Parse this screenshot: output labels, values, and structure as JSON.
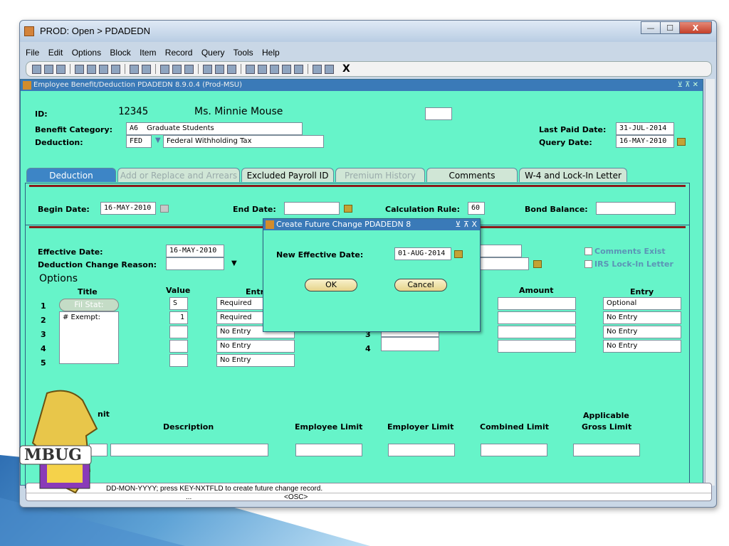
{
  "window": {
    "title": "PROD: Open > PDADEDN",
    "controls": {
      "minimize": "—",
      "maximize": "☐",
      "close": "X"
    }
  },
  "menu": [
    "File",
    "Edit",
    "Options",
    "Block",
    "Item",
    "Record",
    "Query",
    "Tools",
    "Help"
  ],
  "toolbar": {
    "exit_label": "X"
  },
  "form": {
    "title": "Employee Benefit/Deduction  PDADEDN  8.9.0.4  (Prod-MSU)",
    "id_label": "ID:",
    "id_value": "12345",
    "name_value": "Ms. Minnie Mouse",
    "benefit_category_label": "Benefit Category:",
    "benefit_category_code": "A6",
    "benefit_category_desc": "Graduate Students",
    "deduction_label": "Deduction:",
    "deduction_code": "FED",
    "deduction_desc": "Federal Withholding Tax",
    "last_paid_label": "Last Paid Date:",
    "last_paid_value": "31-JUL-2014",
    "query_date_label": "Query Date:",
    "query_date_value": "16-MAY-2010"
  },
  "tabs": [
    {
      "label": "Deduction",
      "state": "active"
    },
    {
      "label": "Add or Replace and Arrears",
      "state": "disabled"
    },
    {
      "label": "Excluded Payroll ID",
      "state": "normal"
    },
    {
      "label": "Premium History",
      "state": "disabled"
    },
    {
      "label": "Comments",
      "state": "normal"
    },
    {
      "label": "W-4 and Lock-In Letter",
      "state": "normal"
    }
  ],
  "deduction": {
    "begin_date_label": "Begin Date:",
    "begin_date_value": "16-MAY-2010",
    "end_date_label": "End Date:",
    "calc_rule_label": "Calculation Rule:",
    "calc_rule_value": "60",
    "bond_balance_label": "Bond Balance:",
    "effective_date_label": "Effective Date:",
    "effective_date_value": "16-MAY-2010",
    "change_reason_label": "Deduction Change Reason:",
    "comments_exist_label": "Comments Exist",
    "irs_lockin_label": "IRS Lock-In Letter",
    "options_label": "Options",
    "col_title": "Title",
    "col_value": "Value",
    "col_entry_left": "Entr",
    "col_amount": "Amount",
    "col_entry_right": "Entry",
    "rows_left": [
      {
        "num": "1",
        "title": "Fil Stat:",
        "value": "S",
        "entry": "Required"
      },
      {
        "num": "2",
        "title": "# Exempt:",
        "value": "1",
        "entry": "Required"
      },
      {
        "num": "3",
        "title": "",
        "value": "",
        "entry": "No Entry"
      },
      {
        "num": "4",
        "title": "",
        "value": "",
        "entry": "No Entry"
      },
      {
        "num": "5",
        "title": "",
        "value": "",
        "entry": "No Entry"
      }
    ],
    "rows_right": [
      {
        "num": "",
        "amount": "",
        "entry": "Optional"
      },
      {
        "num": "2",
        "amount": "",
        "entry": "No Entry"
      },
      {
        "num": "3",
        "amount": "",
        "entry": "No Entry"
      },
      {
        "num": "4",
        "amount": "",
        "entry": "No Entry"
      }
    ],
    "limit_partial_label": "nit",
    "limit_c_label": "C",
    "description_label": "Description",
    "employee_limit_label": "Employee Limit",
    "employer_limit_label": "Employer Limit",
    "combined_limit_label": "Combined Limit",
    "applicable_label": "Applicable",
    "gross_limit_label": "Gross Limit"
  },
  "dialog": {
    "title": "Create Future Change  PDADEDN  8",
    "title_controls": "⊻ ⊼ X",
    "new_eff_date_label": "New Effective Date:",
    "new_eff_date_value": "01-AUG-2014",
    "ok_label": "OK",
    "cancel_label": "Cancel"
  },
  "status": {
    "message": "DD-MON-YYYY; press KEY-NXTFLD to create future change record.",
    "record_info": "...",
    "osc": "<OSC>"
  },
  "logo": {
    "text": "MBUG"
  },
  "colors": {
    "form_bg": "#66f4c9",
    "title_bg": "#3a7ab8",
    "tab_active": "#3d85c6"
  }
}
